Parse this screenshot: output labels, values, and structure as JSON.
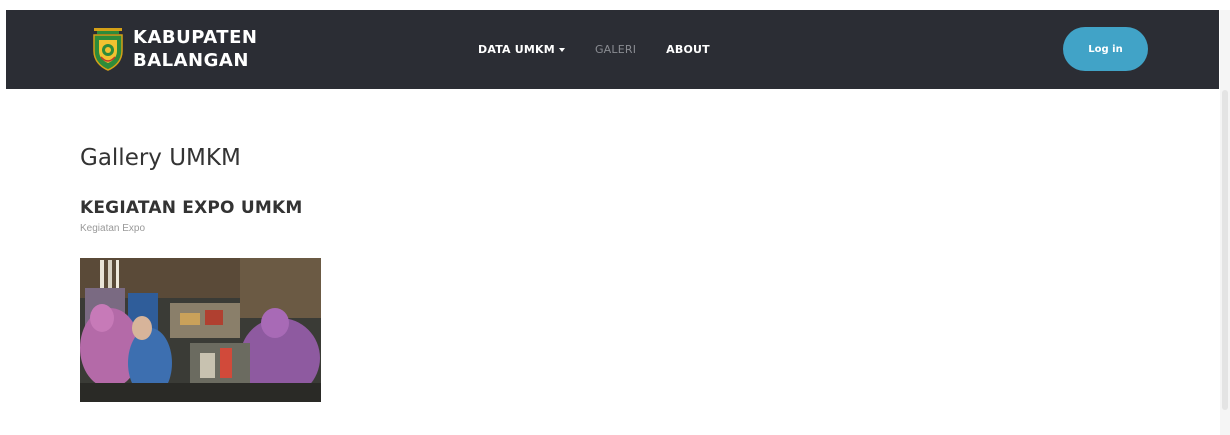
{
  "header": {
    "brand": {
      "line1": "KABUPATEN",
      "line2": "BALANGAN",
      "logo_icon": "kabupaten-balangan-emblem"
    },
    "nav": [
      {
        "label": "DATA UMKM",
        "has_dropdown": true,
        "active": false
      },
      {
        "label": "GALERI",
        "has_dropdown": false,
        "active": true
      },
      {
        "label": "ABOUT",
        "has_dropdown": false,
        "active": false
      }
    ],
    "login_label": "Log in",
    "colors": {
      "navbar_bg": "#2b2d34",
      "login_bg": "#41a3c7"
    }
  },
  "main": {
    "title": "Gallery UMKM",
    "items": [
      {
        "title": "KEGIATAN EXPO UMKM",
        "subtitle": "Kegiatan Expo"
      }
    ]
  }
}
